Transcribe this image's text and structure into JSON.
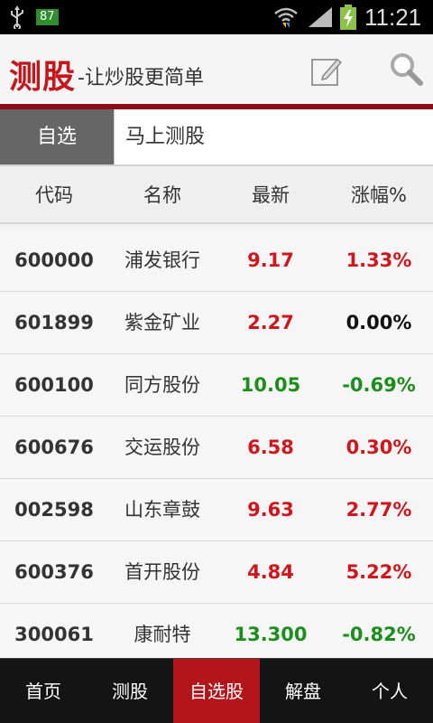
{
  "status_bar": {
    "battery_level": "87",
    "time": "11:21",
    "icons": [
      "usb-icon",
      "wifi-icon",
      "signal-icon",
      "battery-charging-icon"
    ]
  },
  "header": {
    "logo": "测股",
    "slogan": "-让炒股更简单",
    "icons": [
      "edit-icon",
      "search-icon"
    ],
    "brand_color": "#c4161c"
  },
  "tabs": [
    {
      "label": "自选",
      "active": true
    },
    {
      "label": "马上测股",
      "active": false
    }
  ],
  "columns": [
    "代码",
    "名称",
    "最新",
    "涨幅%"
  ],
  "stocks": [
    {
      "code": "600000",
      "name": "浦发银行",
      "price": "9.17",
      "change": "1.33%",
      "trend": "up"
    },
    {
      "code": "601899",
      "name": "紫金矿业",
      "price": "2.27",
      "change": "0.00%",
      "trend": "flat"
    },
    {
      "code": "600100",
      "name": "同方股份",
      "price": "10.05",
      "change": "-0.69%",
      "trend": "down"
    },
    {
      "code": "600676",
      "name": "交运股份",
      "price": "6.58",
      "change": "0.30%",
      "trend": "up"
    },
    {
      "code": "002598",
      "name": "山东章鼓",
      "price": "9.63",
      "change": "2.77%",
      "trend": "up"
    },
    {
      "code": "600376",
      "name": "首开股份",
      "price": "4.84",
      "change": "5.22%",
      "trend": "up"
    },
    {
      "code": "300061",
      "name": "康耐特",
      "price": "13.300",
      "change": "-0.82%",
      "trend": "down"
    }
  ],
  "colors": {
    "up": "#d0161c",
    "down": "#1b8e1b",
    "flat": "#111111",
    "nav_active": "#b3151a"
  },
  "bottom_nav": [
    {
      "label": "首页",
      "active": false
    },
    {
      "label": "测股",
      "active": false
    },
    {
      "label": "自选股",
      "active": true
    },
    {
      "label": "解盘",
      "active": false
    },
    {
      "label": "个人",
      "active": false
    }
  ]
}
